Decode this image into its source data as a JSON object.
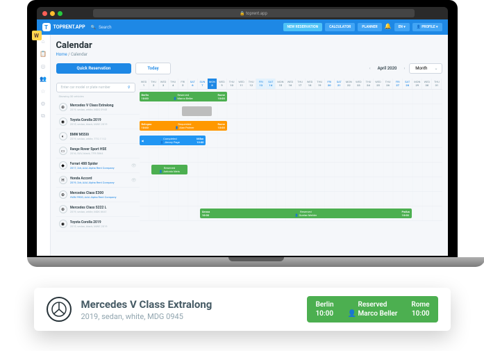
{
  "browser": {
    "url": "toprent.app"
  },
  "header": {
    "logo": "TOPRENT.APP",
    "search_placeholder": "Search",
    "new_reservation": "NEW RESERVATION",
    "calculator": "CALCULATOR",
    "planner": "PLANNER",
    "lang": "EN",
    "profile": "PROFILE"
  },
  "workspace": {
    "badge": "W"
  },
  "page": {
    "title": "Calendar",
    "breadcrumb_home": "Home",
    "breadcrumb_current": "Calendar"
  },
  "toolbar": {
    "quick": "Quick Reservation",
    "today": "Today",
    "month_label": "April 2020",
    "view": "Month"
  },
  "search_vehicle": {
    "placeholder": "Enter car model or plate number",
    "showing": "Showing 30 vehicles"
  },
  "days": [
    {
      "d": "WED",
      "n": "1"
    },
    {
      "d": "THU",
      "n": "2"
    },
    {
      "d": "WED",
      "n": "3"
    },
    {
      "d": "THU",
      "n": "4"
    },
    {
      "d": "FRI",
      "n": "5"
    },
    {
      "d": "SAT",
      "n": "6",
      "w": 1
    },
    {
      "d": "SUN",
      "n": "7",
      "w": 1
    },
    {
      "d": "MON",
      "n": "8",
      "a": 1
    },
    {
      "d": "WED",
      "n": "9"
    },
    {
      "d": "THU",
      "n": "10"
    },
    {
      "d": "WED",
      "n": "11"
    },
    {
      "d": "THU",
      "n": "12"
    },
    {
      "d": "FRI",
      "n": "13",
      "h": 1
    },
    {
      "d": "SAT",
      "n": "14",
      "h": 1
    },
    {
      "d": "MON",
      "n": "15"
    },
    {
      "d": "WED",
      "n": "16"
    },
    {
      "d": "THU",
      "n": "17"
    },
    {
      "d": "WED",
      "n": "18"
    },
    {
      "d": "THU",
      "n": "19"
    },
    {
      "d": "FRI",
      "n": "20",
      "w": 1
    },
    {
      "d": "SAT",
      "n": "21",
      "w": 1
    },
    {
      "d": "MON",
      "n": "22"
    },
    {
      "d": "WED",
      "n": "23"
    },
    {
      "d": "THU",
      "n": "24"
    },
    {
      "d": "WED",
      "n": "25"
    },
    {
      "d": "THU",
      "n": "26"
    },
    {
      "d": "FRI",
      "n": "27",
      "w": 1
    },
    {
      "d": "SAT",
      "n": "28",
      "w": 1
    },
    {
      "d": "MON",
      "n": "29"
    },
    {
      "d": "WED",
      "n": "30"
    },
    {
      "d": "THU",
      "n": "31"
    }
  ],
  "vehicles": [
    {
      "name": "Mercedes V Class Extralong",
      "meta": "2019, sedan, white, MDG 0945",
      "logo": "⊕"
    },
    {
      "name": "Toyota Corolla 2019",
      "meta": "2015, sedan, black, MWE 2019",
      "logo": "◉"
    },
    {
      "name": "BMW M550i",
      "meta": "2019, sedan, white, TTG 1112",
      "logo": "◐"
    },
    {
      "name": "Range Rover Sport HSE",
      "meta": "2016, SUV, black, TFR 5864",
      "logo": "▭"
    },
    {
      "name": "Ferrari 488 Spider",
      "meta": "2017, 2dr, AAA Alpha Rent Company",
      "logo": "◆",
      "link": true,
      "eye": true
    },
    {
      "name": "Honda Accord",
      "meta": "2019, 2dr, AAA Alpha Rent Company",
      "logo": "H",
      "link": true,
      "eye": true
    },
    {
      "name": "Mercedes Class E300",
      "meta": "HWN 9900, AAA Alpha Rent Company",
      "logo": "⊕",
      "link": true
    },
    {
      "name": "Mercedes Class S222 L",
      "meta": "2019, sedan, white, MDK 6641",
      "logo": "⊕"
    },
    {
      "name": "Toyota Corolla 2019",
      "meta": "2015, sedan, black, MWE 2019",
      "logo": "◉"
    }
  ],
  "reservations": [
    {
      "row": 0,
      "cls": "res-green",
      "l": "0%",
      "w": "29%",
      "from": "Berlin",
      "ft": "10:00",
      "status": "Reserved",
      "person": "Marco Beller",
      "to": "Rome",
      "tt": "10:00"
    },
    {
      "row": 1,
      "cls": "res-grey",
      "l": "14%",
      "w": "10%"
    },
    {
      "row": 2,
      "cls": "res-orange",
      "l": "0%",
      "w": "29%",
      "from": "Bologna",
      "ft": "10:00",
      "status": "Requested",
      "person": "Alan Palmer",
      "to": "Rome",
      "tt": "10:00"
    },
    {
      "row": 3,
      "cls": "res-blue",
      "l": "0%",
      "w": "22%",
      "status": "Completed",
      "person": "Jimmy Page",
      "to": "Milan",
      "tt": "10:00",
      "arrow": true
    },
    {
      "row": 5,
      "cls": "res-green",
      "l": "4%",
      "w": "12%",
      "status": "Reserved",
      "person": "Antonio Meis"
    },
    {
      "row": 8,
      "cls": "res-green",
      "l": "20%",
      "w": "70%",
      "from": "Genoa",
      "ft": "10:00",
      "status": "Reserved",
      "person": "Gustav Mahler",
      "to": "Padua",
      "tt": "10:00"
    }
  ],
  "detail": {
    "name": "Mercedes V Class Extralong",
    "meta": "2019, sedan, white, MDG 0945",
    "from_city": "Berlin",
    "from_time": "10:00",
    "status": "Reserved",
    "person": "Marco Beller",
    "to_city": "Rome",
    "to_time": "10:00"
  }
}
